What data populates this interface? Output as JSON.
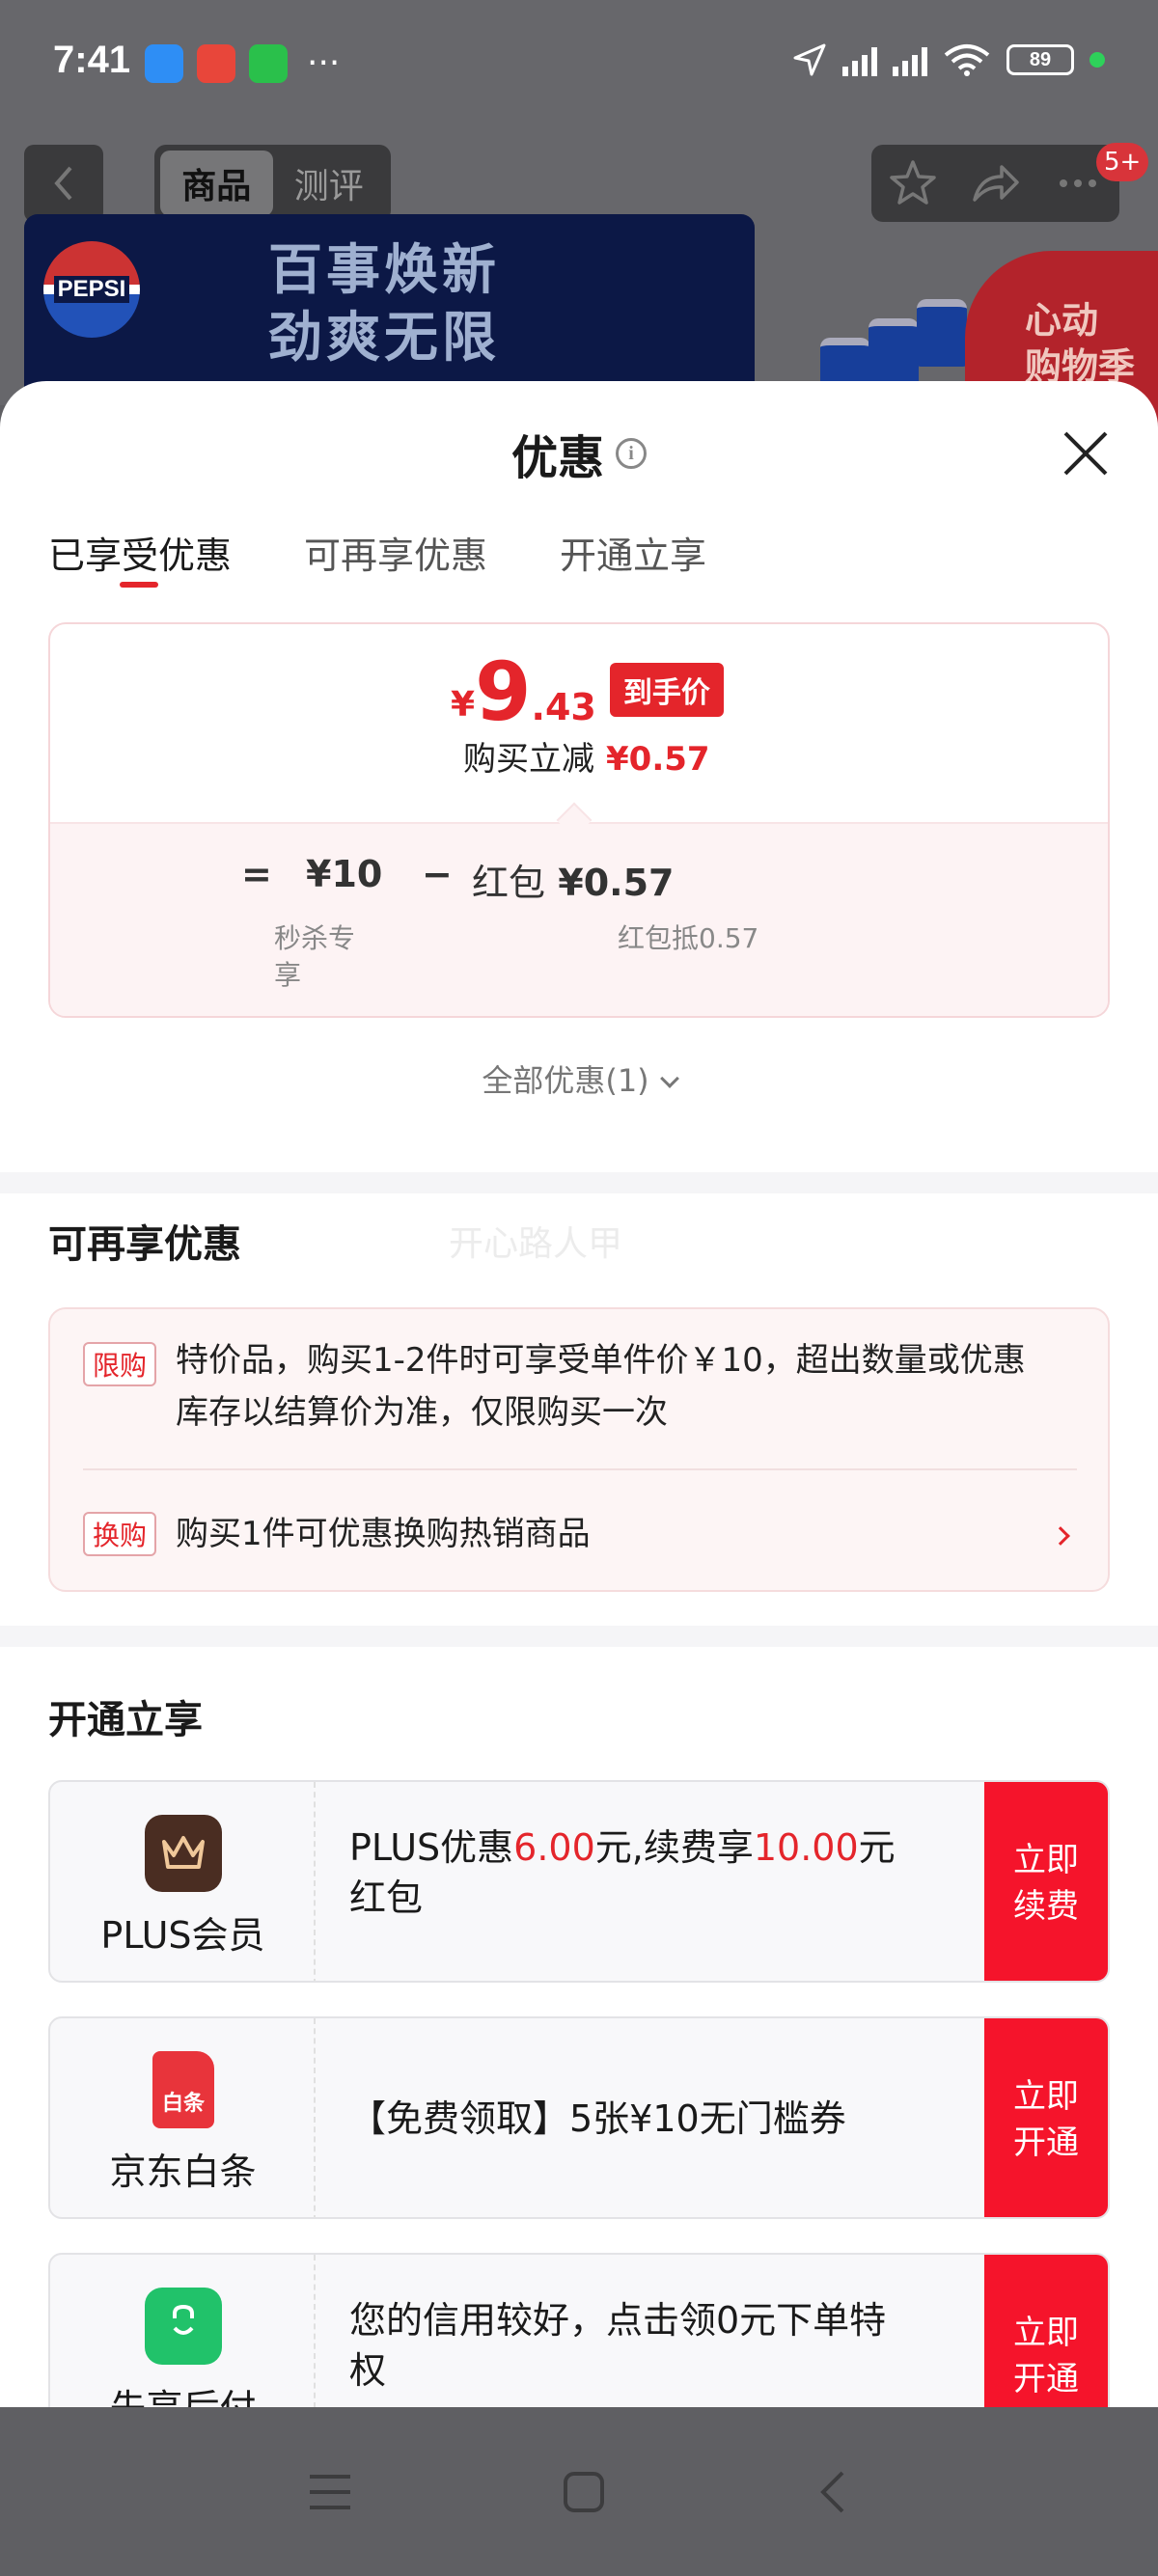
{
  "status_bar": {
    "time": "7:41",
    "battery": "89",
    "more": "···"
  },
  "nav": {
    "tabs": [
      "商品",
      "测评"
    ],
    "badge": "5+"
  },
  "banner": {
    "brand": "PEPSI",
    "line1": "百事焕新",
    "line2": "劲爽无限",
    "tag_line1": "心动",
    "tag_line2": "购物季"
  },
  "sheet": {
    "title": "优惠",
    "tabs": [
      "已享受优惠",
      "可再享优惠",
      "开通立享"
    ],
    "price": {
      "currency": "¥",
      "integer": "9",
      "decimal": ".43",
      "tag": "到手价",
      "reduce_label": "购买立减",
      "reduce_value": "¥0.57"
    },
    "calc": {
      "eq": "=",
      "base_value": "¥10",
      "base_label": "秒杀专享",
      "minus": "−",
      "packet_prefix": "红包",
      "packet_value": "¥0.57",
      "packet_label": "红包抵0.57"
    },
    "all_discounts": "全部优惠(1)"
  },
  "more_discounts": {
    "title": "可再享优惠",
    "watermark": "开心路人甲",
    "items": [
      {
        "tag": "限购",
        "text_line1": "特价品，购买1-2件时可享受单件价￥10，超出数量或优惠",
        "text_line2": "库存以结算价为准，仅限购买一次"
      },
      {
        "tag": "换购",
        "text": "购买1件可优惠换购热销商品"
      }
    ]
  },
  "open_enjoy": {
    "title": "开通立享",
    "offers": [
      {
        "name": "PLUS会员",
        "desc_a": "PLUS优惠",
        "desc_b": "6.00",
        "desc_c": "元,续费享",
        "desc_d": "10.00",
        "desc_e": "元",
        "desc_f": "红包",
        "button": "立即续费",
        "icon_color": "#4a2d22"
      },
      {
        "name": "京东白条",
        "desc": "【免费领取】5张¥10无门槛券",
        "button": "立即开通",
        "icon_label": "白条",
        "icon_color": "#e8343b"
      },
      {
        "name": "先享后付",
        "desc_line1": "您的信用较好，点击领0元下单特",
        "desc_line2": "权",
        "button": "立即开通",
        "icon_color": "#21c26a"
      }
    ]
  },
  "colors": {
    "accent": "#e4252b",
    "button": "#f5142b"
  }
}
